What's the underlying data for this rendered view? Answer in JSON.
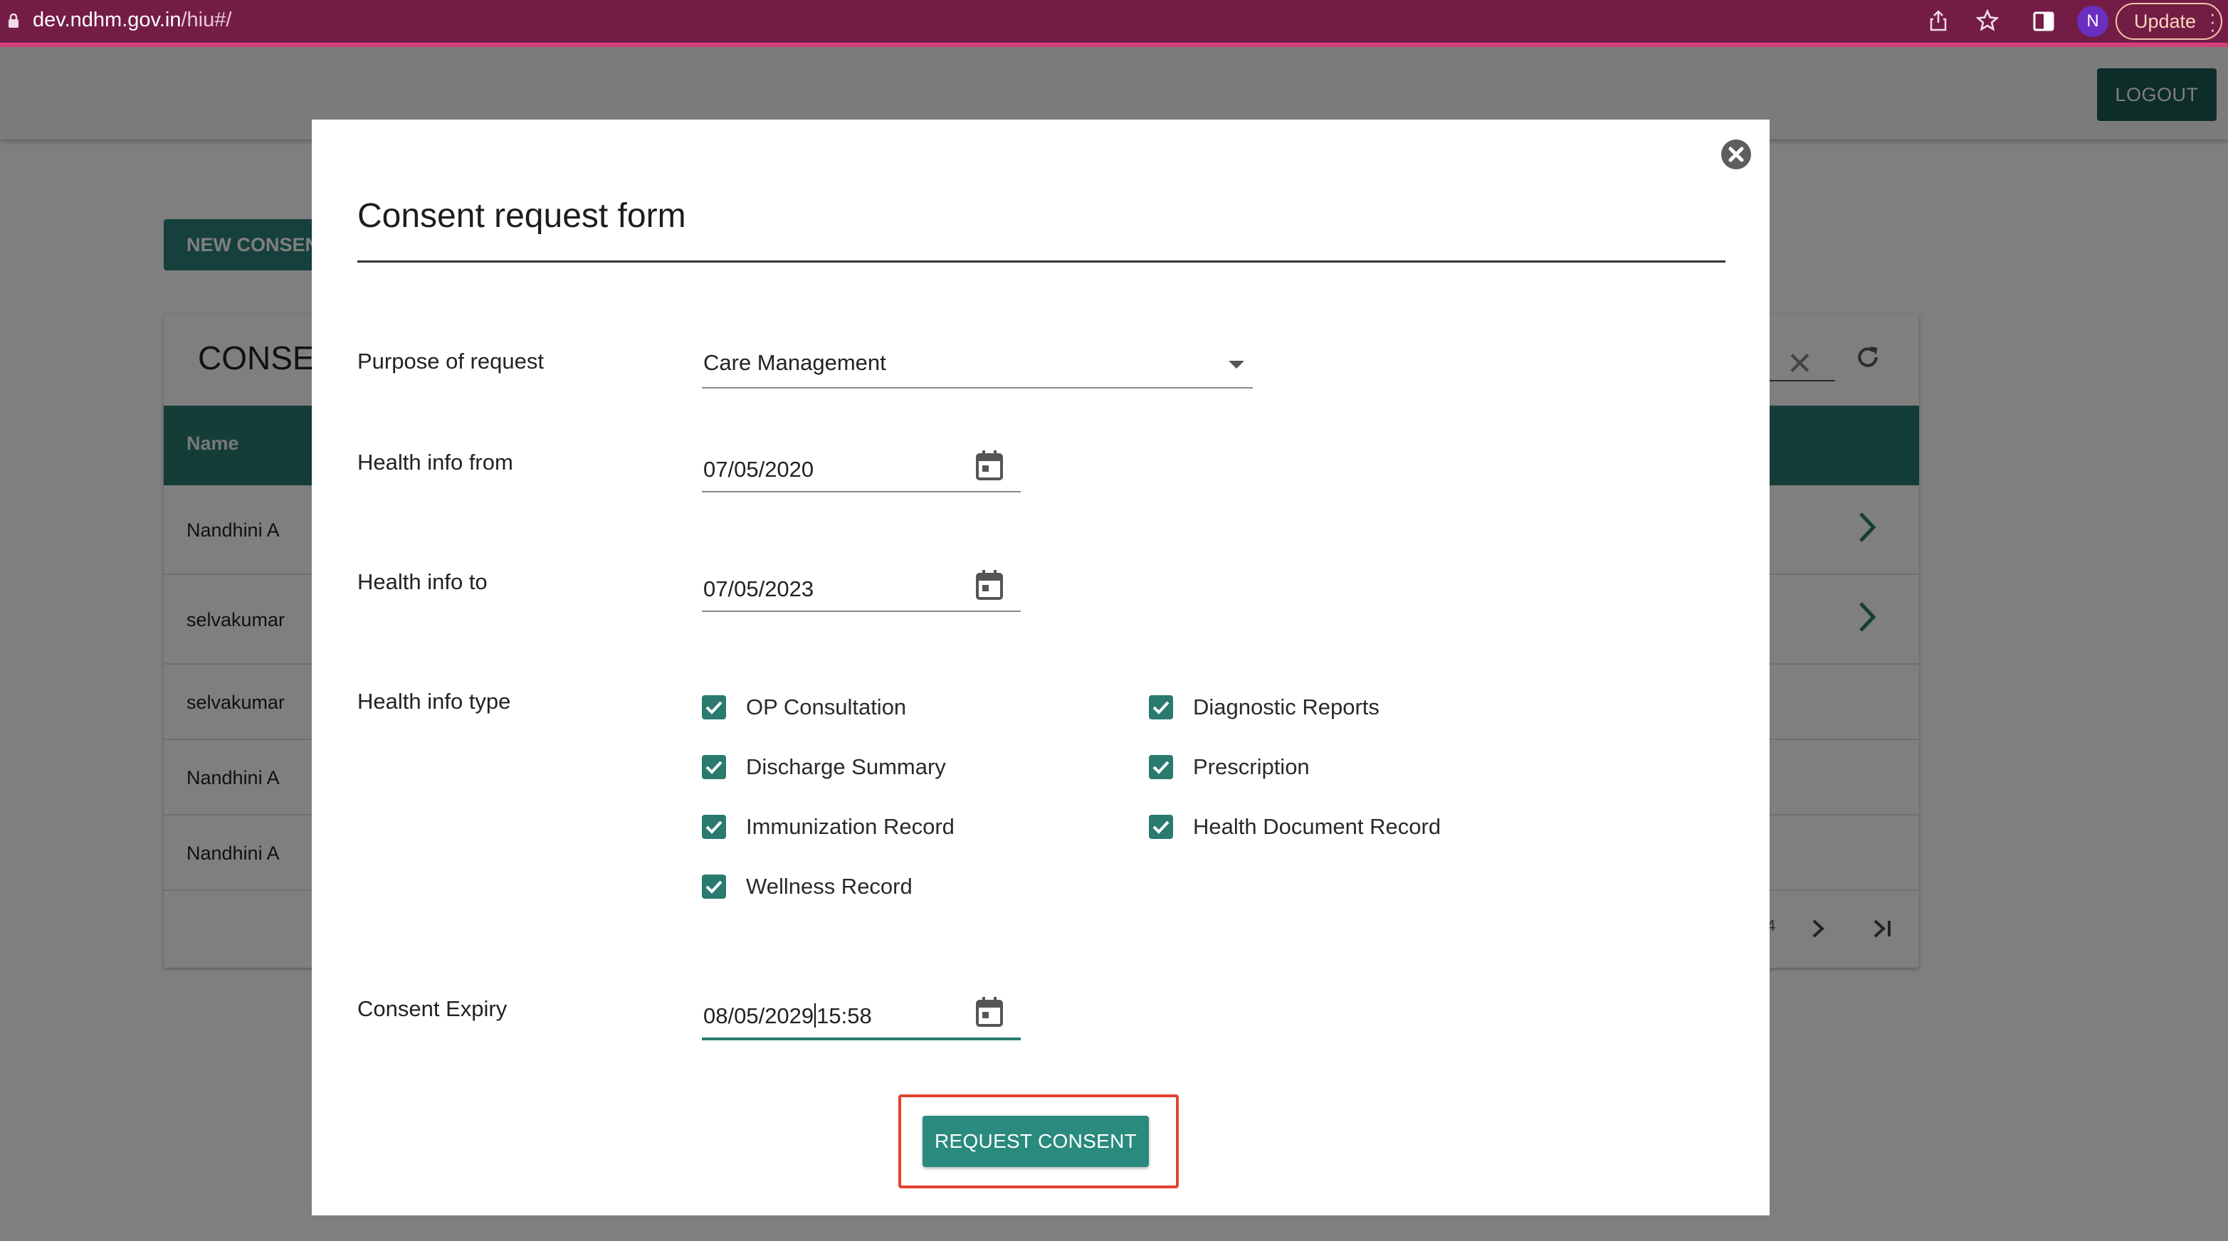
{
  "browser": {
    "url_host": "dev.ndhm.gov.in",
    "url_path": "/hiu#/",
    "profile_initial": "N",
    "update_label": "Update"
  },
  "app": {
    "logout_label": "LOGOUT",
    "new_consent_label": "NEW CONSENT",
    "card_title": "CONSENT",
    "table_headers": [
      "Name"
    ],
    "rows": [
      {
        "name": "Nandhini A",
        "has_chevron": true
      },
      {
        "name": "selvakumar",
        "has_chevron": true
      },
      {
        "name": "selvakumar",
        "has_chevron": false
      },
      {
        "name": "Nandhini A",
        "has_chevron": false
      },
      {
        "name": "Nandhini A",
        "has_chevron": false
      }
    ],
    "pager_fragment": "4"
  },
  "modal": {
    "title": "Consent request form",
    "purpose": {
      "label": "Purpose of request",
      "value": "Care Management"
    },
    "health_info_from": {
      "label": "Health info from",
      "value": "07/05/2020"
    },
    "health_info_to": {
      "label": "Health info to",
      "value": "07/05/2023"
    },
    "health_info_type": {
      "label": "Health info type",
      "options": [
        {
          "label": "OP Consultation",
          "checked": true
        },
        {
          "label": "Diagnostic Reports",
          "checked": true
        },
        {
          "label": "Discharge Summary",
          "checked": true
        },
        {
          "label": "Prescription",
          "checked": true
        },
        {
          "label": "Immunization Record",
          "checked": true
        },
        {
          "label": "Health Document Record",
          "checked": true
        },
        {
          "label": "Wellness Record",
          "checked": true
        }
      ]
    },
    "consent_expiry": {
      "label": "Consent Expiry",
      "value_date": "08/05/2029",
      "value_time": "15:58"
    },
    "submit_label": "REQUEST CONSENT"
  },
  "colors": {
    "browser_bar": "#731d46",
    "accent": "#2a7a6f",
    "highlight": "#e04430"
  }
}
